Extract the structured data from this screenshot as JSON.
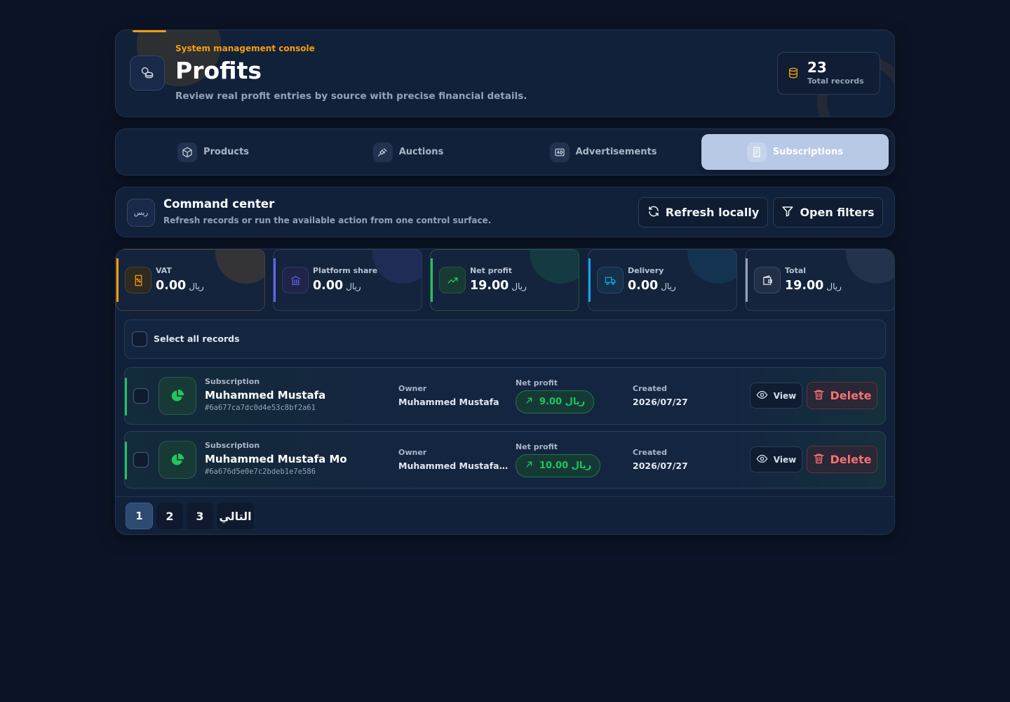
{
  "header": {
    "kicker": "System management console",
    "title": "Profits",
    "subtitle": "Review real profit entries by source with precise financial details.",
    "stat_value": "23",
    "stat_label": "Total records",
    "accent": "#f59e0b"
  },
  "tabs": [
    {
      "label": "Products",
      "icon": "box-icon",
      "active": false
    },
    {
      "label": "Auctions",
      "icon": "gavel-icon",
      "active": false
    },
    {
      "label": "Advertisements",
      "icon": "ad-icon",
      "active": false
    },
    {
      "label": "Subscriptions",
      "icon": "receipt-icon",
      "active": true
    }
  ],
  "command": {
    "icon_text": "ريس",
    "title": "Command center",
    "subtitle": "Refresh records or run the available action from one control surface.",
    "refresh_label": "Refresh locally",
    "filters_label": "Open filters"
  },
  "summary": [
    {
      "label": "VAT",
      "value": "0.00",
      "currency": "ريال",
      "color": "#f59e0b",
      "icon": "receipt-percent-icon"
    },
    {
      "label": "Platform share",
      "value": "0.00",
      "currency": "ريال",
      "color": "#6366f1",
      "icon": "bank-icon"
    },
    {
      "label": "Net profit",
      "value": "19.00",
      "currency": "ريال",
      "color": "#22c55e",
      "icon": "trending-up-icon"
    },
    {
      "label": "Delivery",
      "value": "0.00",
      "currency": "ريال",
      "color": "#0ea5e9",
      "icon": "truck-icon"
    },
    {
      "label": "Total",
      "value": "19.00",
      "currency": "ريال",
      "color": "#94a3b8",
      "icon": "wallet-icon"
    }
  ],
  "select_all_label": "Select all records",
  "records": [
    {
      "kind": "Subscription",
      "name": "Muhammed Mustafa",
      "id": "#6a677ca7dc0d4e53c8bf2a61",
      "owner_label": "Owner",
      "owner": "Muhammed Mustafa",
      "net_label": "Net profit",
      "net_value": "9.00 ريال",
      "created_label": "Created",
      "created": "2026/07/27",
      "view_label": "View",
      "delete_label": "Delete"
    },
    {
      "kind": "Subscription",
      "name": "Muhammed Mustafa Mo",
      "id": "#6a676d5e0e7c2bdeb1e7e586",
      "owner_label": "Owner",
      "owner": "Muhammed Mustafa ...",
      "net_label": "Net profit",
      "net_value": "10.00 ريال",
      "created_label": "Created",
      "created": "2026/07/27",
      "view_label": "View",
      "delete_label": "Delete"
    }
  ],
  "pagination": {
    "pages": [
      "1",
      "2",
      "3"
    ],
    "current": "1",
    "next_label": "التالي"
  }
}
